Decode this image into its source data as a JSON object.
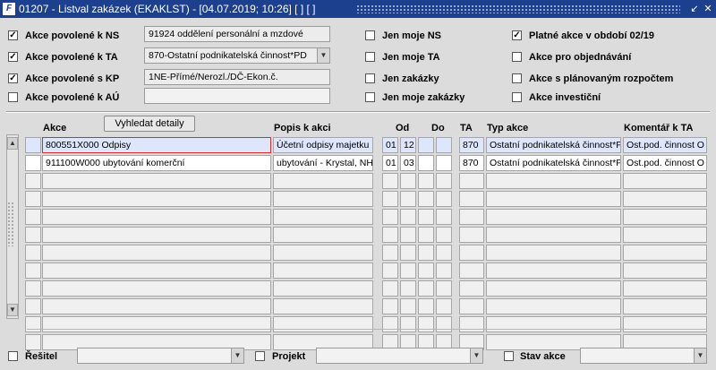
{
  "window": {
    "app_icon": "F",
    "title": "01207 - Listval zakázek (EKAKLST) - [04.07.2019; 10:26]  [ ]  [ ]",
    "buttons": [
      "↙",
      "✕"
    ]
  },
  "filters_left": [
    {
      "label": "Akce povolené k NS",
      "checked": true,
      "value": "91924 oddělení personální a mzdové",
      "combo": false
    },
    {
      "label": "Akce povolené k TA",
      "checked": true,
      "value": "870-Ostatní podnikatelská činnost*PD",
      "combo": true
    },
    {
      "label": "Akce povolené s KP",
      "checked": true,
      "value": "1NE-Přímé/Nerozl./DČ-Ekon.č.",
      "combo": false
    },
    {
      "label": "Akce povolené k AÚ",
      "checked": false,
      "value": "",
      "combo": false
    }
  ],
  "filters_mid": [
    {
      "label": "Jen moje NS",
      "checked": false
    },
    {
      "label": "Jen moje TA",
      "checked": false
    },
    {
      "label": "Jen zakázky",
      "checked": false
    },
    {
      "label": "Jen moje zakázky",
      "checked": false
    }
  ],
  "filters_right": [
    {
      "label": "Platné akce v období 02/19",
      "checked": true
    },
    {
      "label": "Akce pro objednávání",
      "checked": false
    },
    {
      "label": "Akce s plánovaným rozpočtem",
      "checked": false
    },
    {
      "label": "Akce investiční",
      "checked": false
    }
  ],
  "check_mark": "✓",
  "grid": {
    "detail_button": "Vyhledat detaily",
    "headers": {
      "akce": "Akce",
      "popis": "Popis k akci",
      "od": "Od",
      "do": "Do",
      "ta": "TA",
      "typ": "Typ akce",
      "koment": "Komentář k TA"
    },
    "rows": [
      {
        "akce": "800551X000 Odpisy",
        "popis": "Účetní odpisy majetku",
        "od1": "01",
        "od2": "12",
        "ta": "870",
        "typ": "Ostatní podnikatelská činnost*P",
        "koment": "Ost.pod. činnost O"
      },
      {
        "akce": "911100W000 ubytování komerční",
        "popis": "ubytování - Krystal, NH",
        "od1": "01",
        "od2": "03",
        "ta": "870",
        "typ": "Ostatní podnikatelská činnost*P",
        "koment": "Ost.pod. činnost O"
      }
    ],
    "empty_rows": 10
  },
  "bottom": {
    "resitel": "Řešitel",
    "projekt": "Projekt",
    "stav": "Stav akce"
  }
}
